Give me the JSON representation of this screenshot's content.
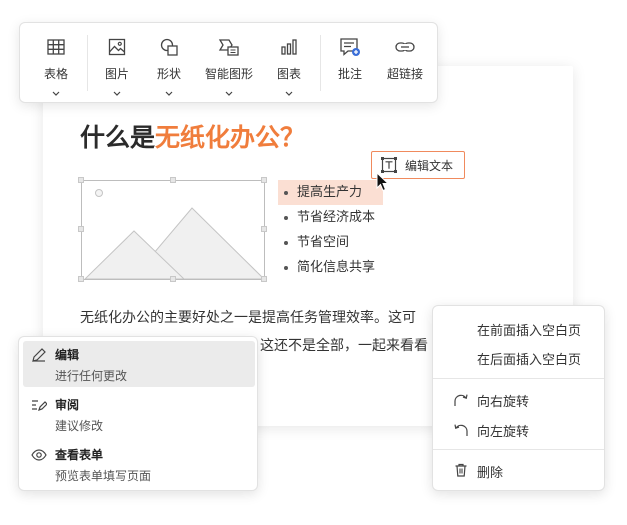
{
  "toolbar": {
    "items": [
      {
        "label": "表格",
        "icon": "table-icon"
      },
      {
        "label": "图片",
        "icon": "image-icon"
      },
      {
        "label": "形状",
        "icon": "shapes-icon"
      },
      {
        "label": "智能图形",
        "icon": "smart-graphic-icon"
      },
      {
        "label": "图表",
        "icon": "chart-icon"
      },
      {
        "label": "批注",
        "icon": "comment-icon"
      },
      {
        "label": "超链接",
        "icon": "link-icon"
      }
    ]
  },
  "document": {
    "title_prefix": "什么是",
    "title_highlight": "无纸化办公？",
    "bullets": [
      "提高生产力",
      "节省经济成本",
      "节省空间",
      "简化信息共享"
    ],
    "edit_text_button": "编辑文本",
    "paragraph_line1": "无纸化办公的主要好处之一是提高任务管理效率。这可",
    "paragraph_line2": "这还不是全部，一起来看看"
  },
  "left_menu": {
    "items": [
      {
        "title": "编辑",
        "desc": "进行任何更改",
        "icon": "pencil-icon",
        "active": true
      },
      {
        "title": "审阅",
        "desc": "建议修改",
        "icon": "review-icon",
        "active": false
      },
      {
        "title": "查看表单",
        "desc": "预览表单填写页面",
        "icon": "eye-icon",
        "active": false
      }
    ]
  },
  "right_menu": {
    "insert_before": "在前面插入空白页",
    "insert_after": "在后面插入空白页",
    "rotate_right": "向右旋转",
    "rotate_left": "向左旋转",
    "delete": "删除"
  },
  "colors": {
    "accent": "#f07d3c",
    "selection": "#fbdfd3",
    "edit_border": "#f08a5d",
    "icon": "#444444"
  }
}
